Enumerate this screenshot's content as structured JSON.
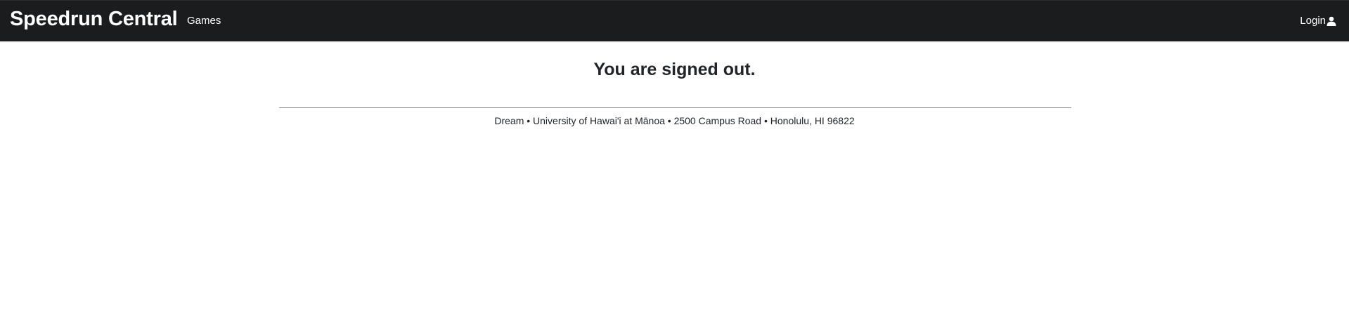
{
  "navbar": {
    "brand": "Speedrun Central",
    "links": [
      {
        "label": "Games"
      }
    ],
    "login_label": "Login",
    "login_icon": "user-icon",
    "background_color": "#1b1c1d"
  },
  "main": {
    "title": "You are signed out."
  },
  "footer": {
    "text": "Dream • University of Hawai'i at Mānoa • 2500 Campus Road • Honolulu, HI 96822"
  }
}
